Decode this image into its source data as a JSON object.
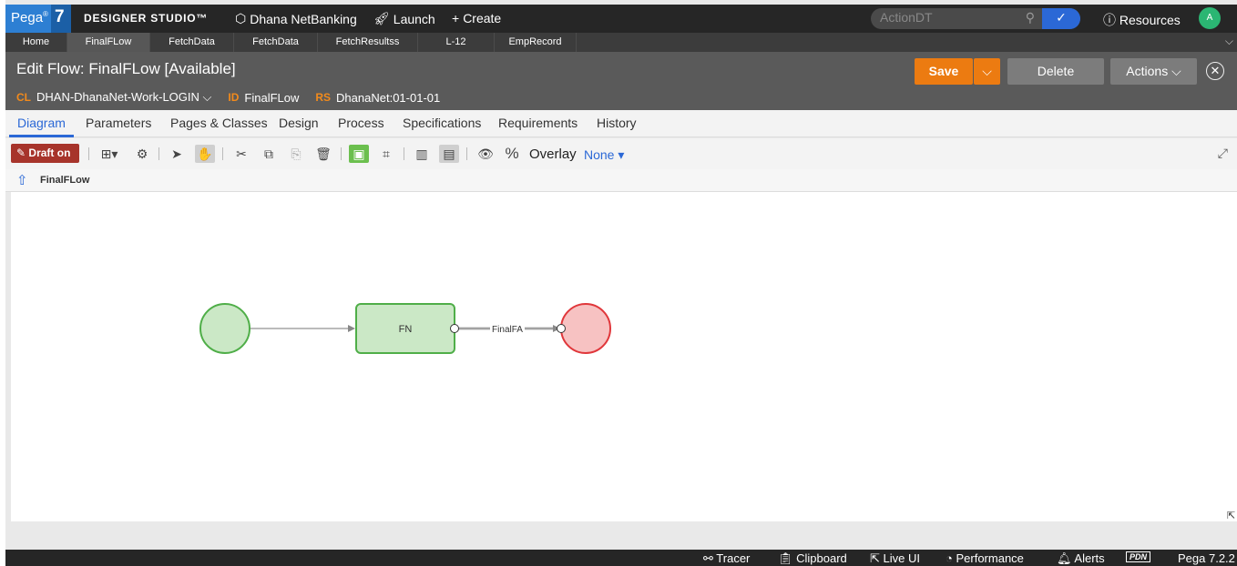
{
  "topbar": {
    "logo_text": "Pega",
    "logo_sup": "®",
    "logo_version": "7",
    "studio_title": "DESIGNER STUDIO™",
    "app_name": "Dhana NetBanking",
    "launch_label": "Launch",
    "create_label": "Create",
    "search_value": "ActionDT",
    "resources_label": "Resources",
    "avatar_initial": "A"
  },
  "tabs": [
    "Home",
    "FinalFLow",
    "FetchData",
    "FetchData",
    "FetchResultss",
    "L-12",
    "EmpRecord"
  ],
  "edit": {
    "title": "Edit Flow: FinalFLow [Available]",
    "cl_key": "CL",
    "cl_value": "DHAN-DhanaNet-Work-LOGIN",
    "id_key": "ID",
    "id_value": "FinalFLow",
    "rs_key": "RS",
    "rs_value": "DhanaNet:01-01-01",
    "save_label": "Save",
    "delete_label": "Delete",
    "actions_label": "Actions"
  },
  "subtabs": [
    "Diagram",
    "Parameters",
    "Pages & Classes",
    "Design",
    "Process",
    "Specifications",
    "Requirements",
    "History"
  ],
  "toolbar": {
    "draft_label": "Draft on",
    "overlay_label": "Overlay",
    "overlay_value": "None"
  },
  "breadcrumb": "FinalFLow",
  "flow": {
    "shape_label": "FN",
    "connector_label": "FinalFA"
  },
  "statusbar": {
    "tracer": "Tracer",
    "clipboard": "Clipboard",
    "live_ui": "Live UI",
    "performance": "Performance",
    "alerts": "Alerts",
    "pdn": "PDN",
    "version": "Pega 7.2.2"
  },
  "colors": {
    "accent_blue": "#2b68d6",
    "save_orange": "#ec7b11",
    "draft_red": "#a7342b",
    "start_green": "#cbe8c6",
    "end_red": "#f7c2c2"
  }
}
